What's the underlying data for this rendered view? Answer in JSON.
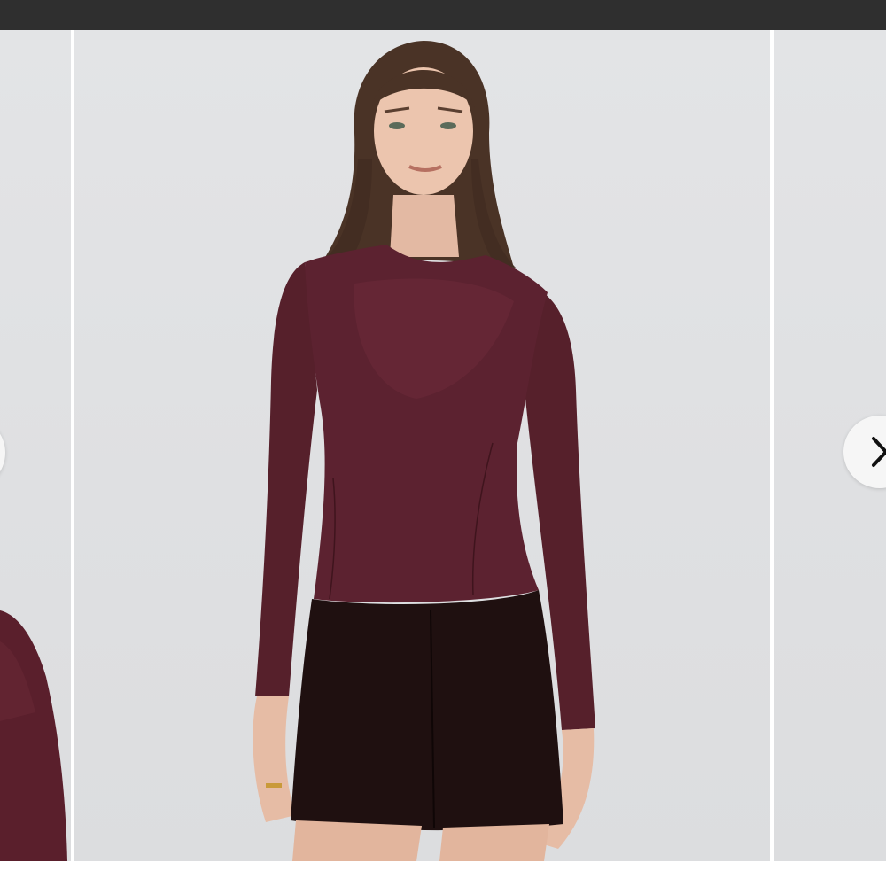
{
  "app": {
    "top_bar_color": "#2f2f2f"
  },
  "carousel": {
    "background_color": "#e1e2e4",
    "product_color": "#5a1f2c",
    "skirt_color": "#1f1010",
    "prev_icon": "chevron-left-icon",
    "next_icon": "chevron-right-icon"
  }
}
